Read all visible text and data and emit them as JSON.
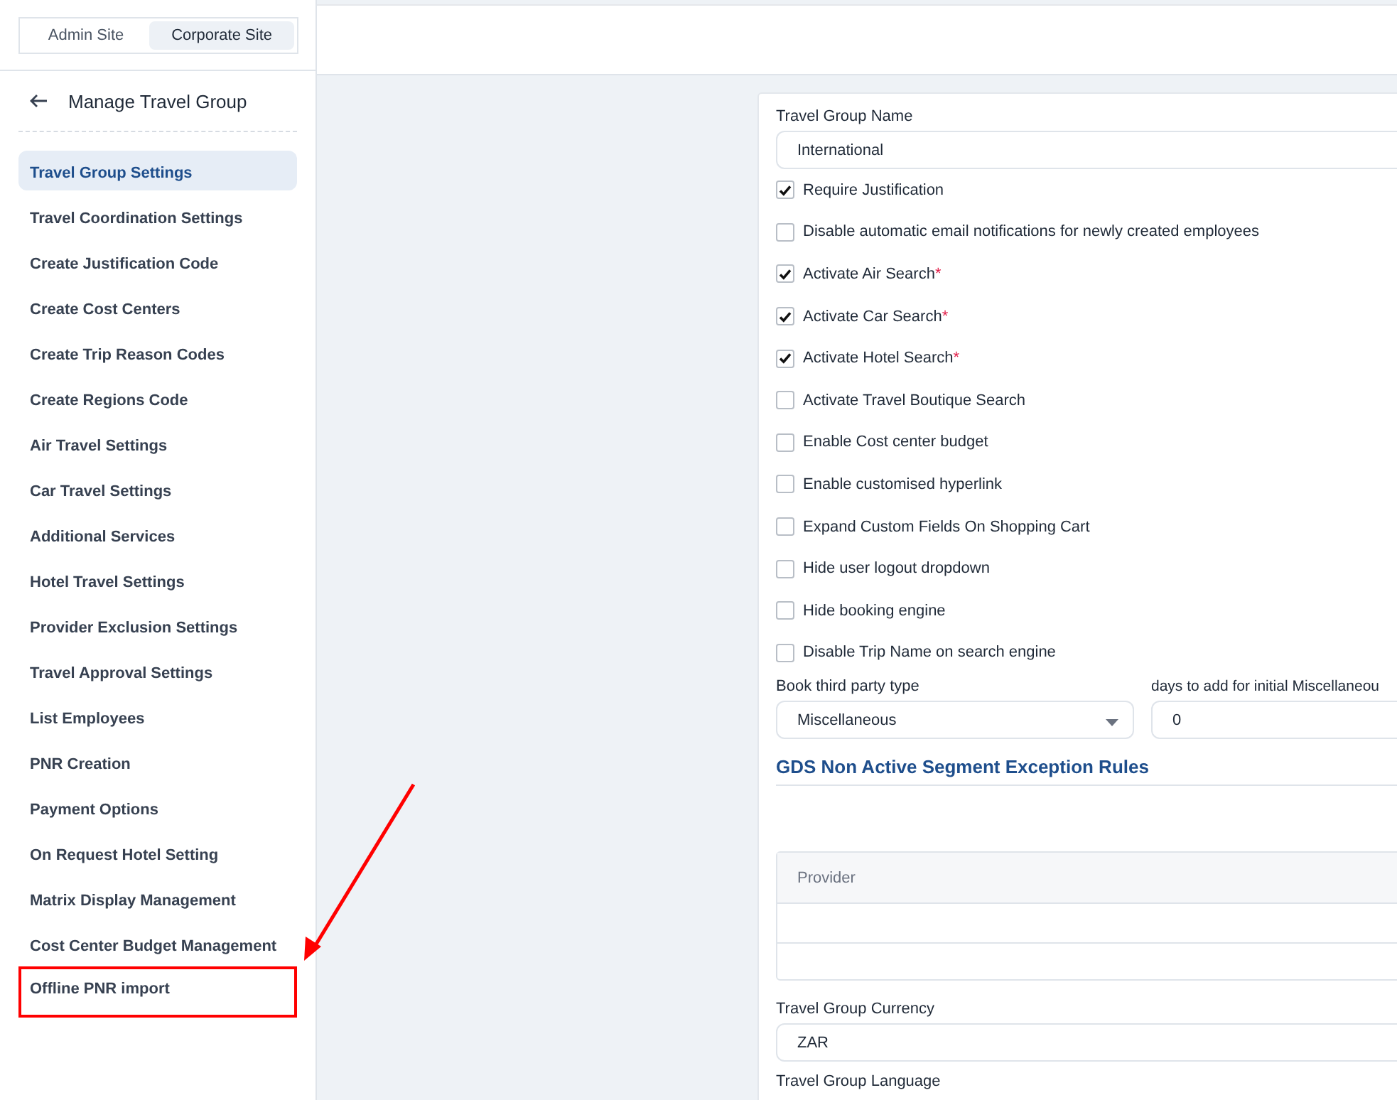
{
  "site_switch": [
    {
      "label": "Admin Site",
      "selected": false
    },
    {
      "label": "Corporate Site",
      "selected": true
    }
  ],
  "sidebar": {
    "title": "Manage Travel Group",
    "items": [
      {
        "label": "Travel Group Settings",
        "selected": true,
        "highlighted": false
      },
      {
        "label": "Travel Coordination Settings",
        "selected": false,
        "highlighted": false
      },
      {
        "label": "Create Justification Code",
        "selected": false,
        "highlighted": false
      },
      {
        "label": "Create Cost Centers",
        "selected": false,
        "highlighted": false
      },
      {
        "label": "Create Trip Reason Codes",
        "selected": false,
        "highlighted": false
      },
      {
        "label": "Create Regions Code",
        "selected": false,
        "highlighted": false
      },
      {
        "label": "Air Travel Settings",
        "selected": false,
        "highlighted": false
      },
      {
        "label": "Car Travel Settings",
        "selected": false,
        "highlighted": false
      },
      {
        "label": "Additional Services",
        "selected": false,
        "highlighted": false
      },
      {
        "label": "Hotel Travel Settings",
        "selected": false,
        "highlighted": false
      },
      {
        "label": "Provider Exclusion Settings",
        "selected": false,
        "highlighted": false
      },
      {
        "label": "Travel Approval Settings",
        "selected": false,
        "highlighted": false
      },
      {
        "label": "List Employees",
        "selected": false,
        "highlighted": false
      },
      {
        "label": "PNR Creation",
        "selected": false,
        "highlighted": false
      },
      {
        "label": "Payment Options",
        "selected": false,
        "highlighted": false
      },
      {
        "label": "On Request Hotel Setting",
        "selected": false,
        "highlighted": false
      },
      {
        "label": "Matrix Display Management",
        "selected": false,
        "highlighted": false
      },
      {
        "label": "Cost Center Budget Management",
        "selected": false,
        "highlighted": false
      },
      {
        "label": "Offline PNR import",
        "selected": false,
        "highlighted": true
      }
    ]
  },
  "form": {
    "name": {
      "label": "Travel Group Name",
      "value": "International"
    },
    "options": [
      {
        "label": "Require Justification",
        "checked": true
      },
      {
        "label": "Disable automatic email notifications for newly created employees",
        "checked": false
      },
      {
        "label": "Activate Air Search",
        "checked": true,
        "required": "*"
      },
      {
        "label": "Activate Car Search",
        "checked": true,
        "required": "*"
      },
      {
        "label": "Activate Hotel Search",
        "checked": true,
        "required": "*"
      },
      {
        "label": "Activate Travel Boutique Search",
        "checked": false
      },
      {
        "label": "Enable Cost center budget",
        "checked": false
      },
      {
        "label": "Enable customised hyperlink",
        "checked": false
      },
      {
        "label": "Expand Custom Fields On Shopping Cart",
        "checked": false
      },
      {
        "label": "Hide user logout dropdown",
        "checked": false
      },
      {
        "label": "Hide booking engine",
        "checked": false
      },
      {
        "label": "Disable Trip Name on search engine",
        "checked": false
      }
    ],
    "third_party": {
      "label": "Book third party type",
      "value": "Miscellaneous"
    },
    "days": {
      "label": "days to add for initial Miscellaneou",
      "value": "0"
    },
    "section_title": "GDS Non Active Segment Exception Rules",
    "table": {
      "columns": [
        "Provider"
      ]
    },
    "currency": {
      "label": "Travel Group Currency",
      "value": "ZAR"
    },
    "language": {
      "label": "Travel Group Language"
    }
  }
}
